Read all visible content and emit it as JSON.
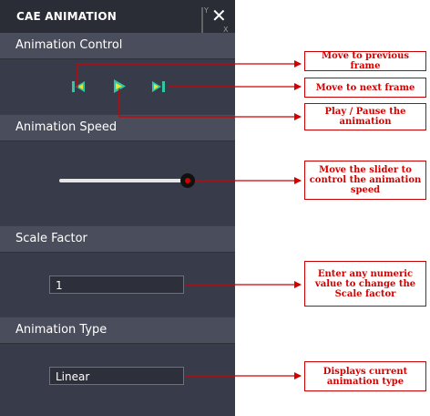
{
  "panel": {
    "title": "CAE ANIMATION",
    "close_glyph": "✕",
    "axes_glyph": "axes-triad-icon"
  },
  "sections": {
    "control": {
      "label": "Animation Control"
    },
    "speed": {
      "label": "Animation Speed",
      "slider_level": 1.0
    },
    "scale": {
      "label": "Scale Factor",
      "value": "1"
    },
    "type": {
      "label": "Animation Type",
      "value": "Linear"
    }
  },
  "controls": {
    "prev_icon": "skip-previous-icon",
    "play_icon": "play-icon",
    "next_icon": "skip-next-icon"
  },
  "callouts": {
    "prev": "Move to previous frame",
    "next": "Move to next frame",
    "play": "Play / Pause the animation",
    "slider": "Move the slider to control the animation speed",
    "scale": "Enter any numeric value to change the Scale factor",
    "type": "Displays current animation type"
  },
  "colors": {
    "panel_bg": "#3a3d4b",
    "header_bg": "#4a4d5c",
    "icon_green": "#2fc8a0",
    "icon_yellow": "#f0e030",
    "callout_red": "#d40000"
  }
}
